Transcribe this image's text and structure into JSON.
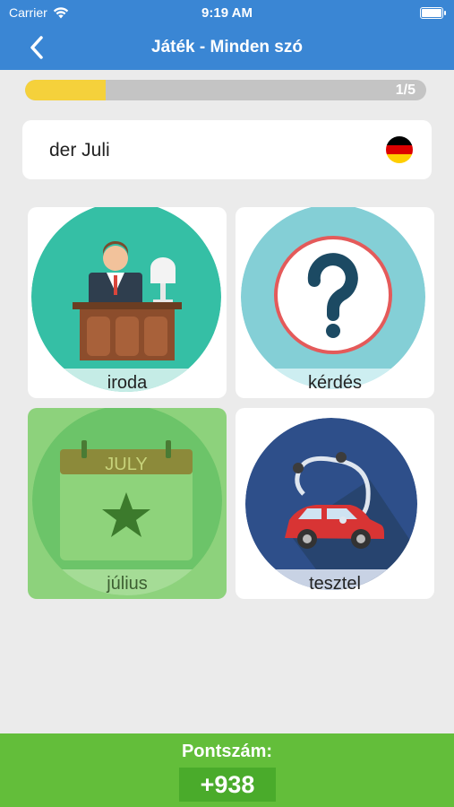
{
  "status_bar": {
    "carrier": "Carrier",
    "time": "9:19 AM"
  },
  "nav": {
    "title": "Játék - Minden szó",
    "back_icon": "chevron-left-icon"
  },
  "progress": {
    "text": "1/5",
    "fraction": 0.2,
    "fill_color": "#f5d13b"
  },
  "prompt": {
    "word": "der Juli",
    "flag_icon": "german-flag-icon"
  },
  "options": [
    {
      "label": "iroda",
      "icon": "office-desk-icon",
      "selected": false
    },
    {
      "label": "kérdés",
      "icon": "question-mark-icon",
      "selected": false
    },
    {
      "label": "július",
      "icon": "july-calendar-icon",
      "calendar_text": "JULY",
      "selected": true
    },
    {
      "label": "tesztel",
      "icon": "car-stethoscope-icon",
      "selected": false
    }
  ],
  "score": {
    "label": "Pontszám:",
    "value": "+938"
  },
  "colors": {
    "header": "#3a86d4",
    "selected_tile": "#8dd27c",
    "score_bar": "#63be3a"
  }
}
